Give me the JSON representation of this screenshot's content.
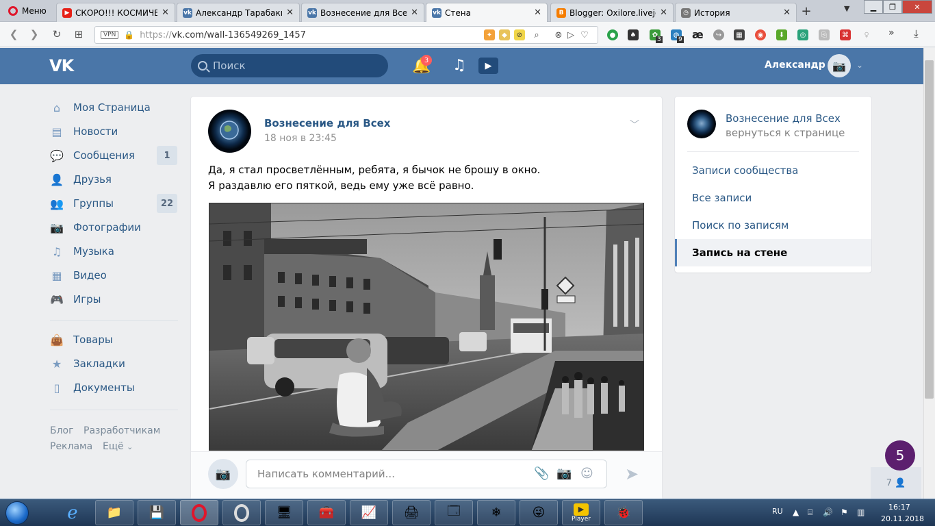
{
  "browser": {
    "menu_label": "Меню",
    "tabs": [
      {
        "title": "СКОРО!!! КОСМИЧЕСКО",
        "icon": "youtube-icon",
        "color": "#e62117"
      },
      {
        "title": "Александр Тарабакин",
        "icon": "vk-icon",
        "color": "#4a76a8"
      },
      {
        "title": "Вознесение для Всех",
        "icon": "vk-icon",
        "color": "#4a76a8"
      },
      {
        "title": "Стена",
        "icon": "vk-icon",
        "color": "#4a76a8"
      },
      {
        "title": "Blogger: Oxilore.livejour",
        "icon": "blogger-icon",
        "color": "#f57d00"
      },
      {
        "title": "История",
        "icon": "history-icon",
        "color": "#777777"
      }
    ],
    "new_tab": "+",
    "url_prefix": "https://",
    "url_main": "vk.com/wall-136549269_1457",
    "vpn_label": "VPN",
    "ext_badges": [
      "3",
      "9"
    ],
    "ext_ae": "æ"
  },
  "vk": {
    "logo": "VK",
    "search_placeholder": "Поиск",
    "notif_count": "3",
    "user_name": "Александр",
    "menu": [
      {
        "label": "Моя Страница",
        "icon": "home-icon"
      },
      {
        "label": "Новости",
        "icon": "news-icon"
      },
      {
        "label": "Сообщения",
        "icon": "messages-icon",
        "badge": "1"
      },
      {
        "label": "Друзья",
        "icon": "friends-icon"
      },
      {
        "label": "Группы",
        "icon": "groups-icon",
        "badge": "22"
      },
      {
        "label": "Фотографии",
        "icon": "camera-icon"
      },
      {
        "label": "Музыка",
        "icon": "music-icon"
      },
      {
        "label": "Видео",
        "icon": "video-icon"
      },
      {
        "label": "Игры",
        "icon": "gamepad-icon"
      },
      {
        "label": "Товары",
        "icon": "bag-icon"
      },
      {
        "label": "Закладки",
        "icon": "star-icon"
      },
      {
        "label": "Документы",
        "icon": "document-icon"
      }
    ],
    "footer": [
      "Блог",
      "Разработчикам",
      "Реклама",
      "Ещё"
    ],
    "post": {
      "author": "Вознесение для Всех",
      "date": "18 ноя в 23:45",
      "text_line1": "Да, я стал просветлённым, ребята, я бычок не брошу в окно.",
      "text_line2": "Я раздавлю его пяткой, ведь ему уже всё равно.",
      "comment_placeholder": "Написать комментарий..."
    },
    "right": {
      "group_name": "Вознесение для Всех",
      "back": "вернуться к странице",
      "items": [
        "Записи сообщества",
        "Все записи",
        "Поиск по записям",
        "Запись на стене"
      ]
    },
    "float_badge": "5",
    "online_count": "7"
  },
  "taskbar": {
    "lang": "RU",
    "time": "16:17",
    "date": "20.11.2018",
    "player_label": "Player"
  }
}
